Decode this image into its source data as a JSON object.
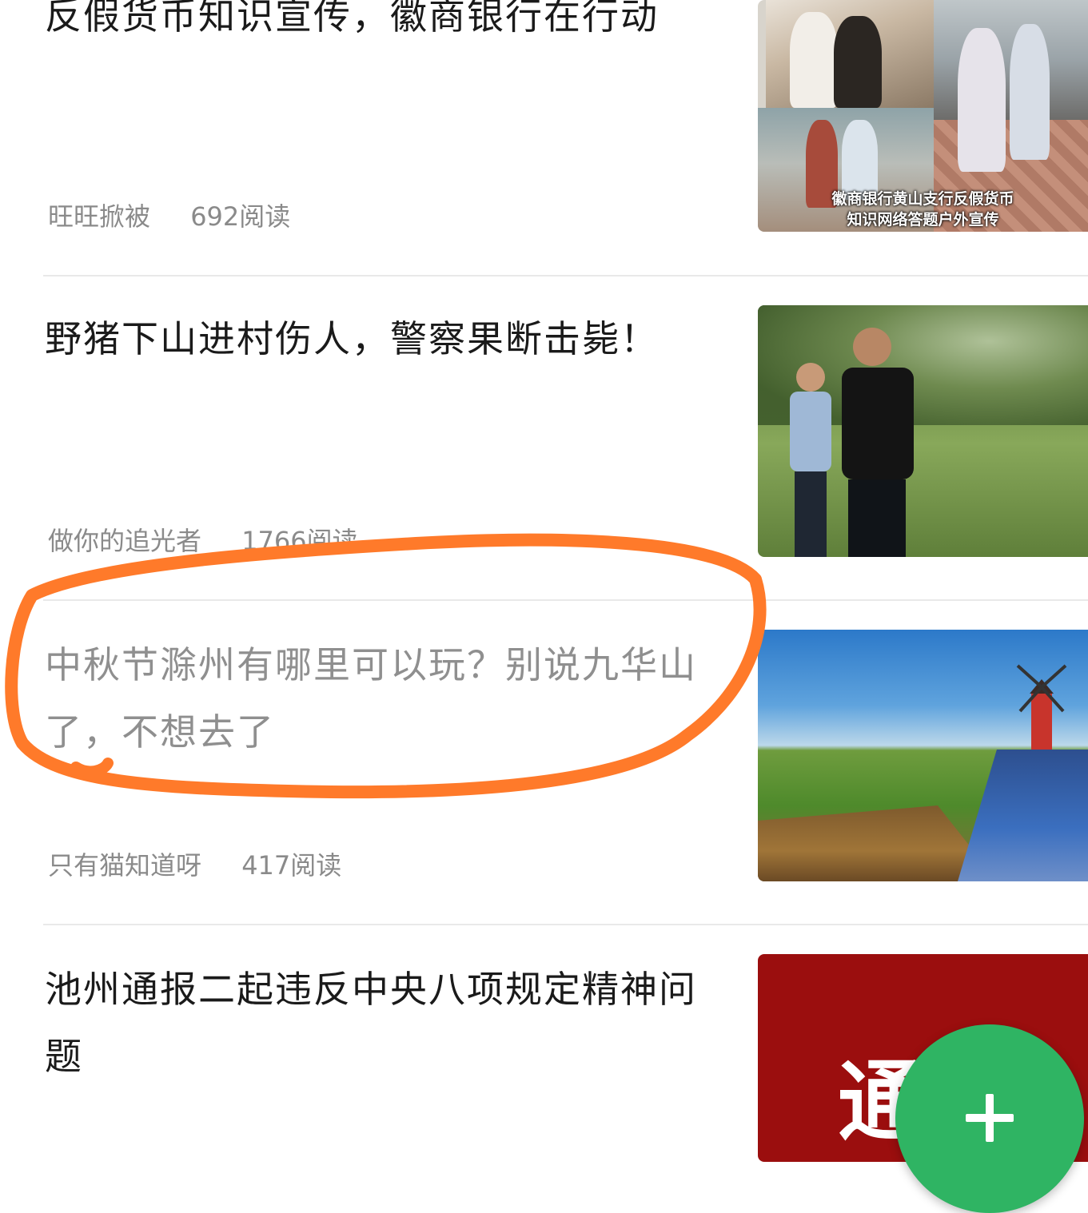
{
  "articles": [
    {
      "title": "反假货币知识宣传，徽商银行在行动",
      "author": "旺旺掀被",
      "reads": "692阅读",
      "thumbnail": {
        "caption_line1": "徽商银行黄山支行反假货币",
        "caption_line2": "知识网络答题户外宣传"
      }
    },
    {
      "title": "野猪下山进村伤人，警察果断击毙！",
      "author": "做你的追光者",
      "reads": "1766阅读"
    },
    {
      "title": "中秋节滁州有哪里可以玩？别说九华山了，不想去了",
      "author": "只有猫知道呀",
      "reads": "417阅读",
      "read_state": "visited",
      "annotation_color": "#ff7a2a"
    },
    {
      "title": "池州通报二起违反中央八项规定精神问题",
      "thumbnail": {
        "text": "通"
      }
    }
  ],
  "fab": {
    "icon": "plus-icon",
    "color": "#2fb463"
  }
}
